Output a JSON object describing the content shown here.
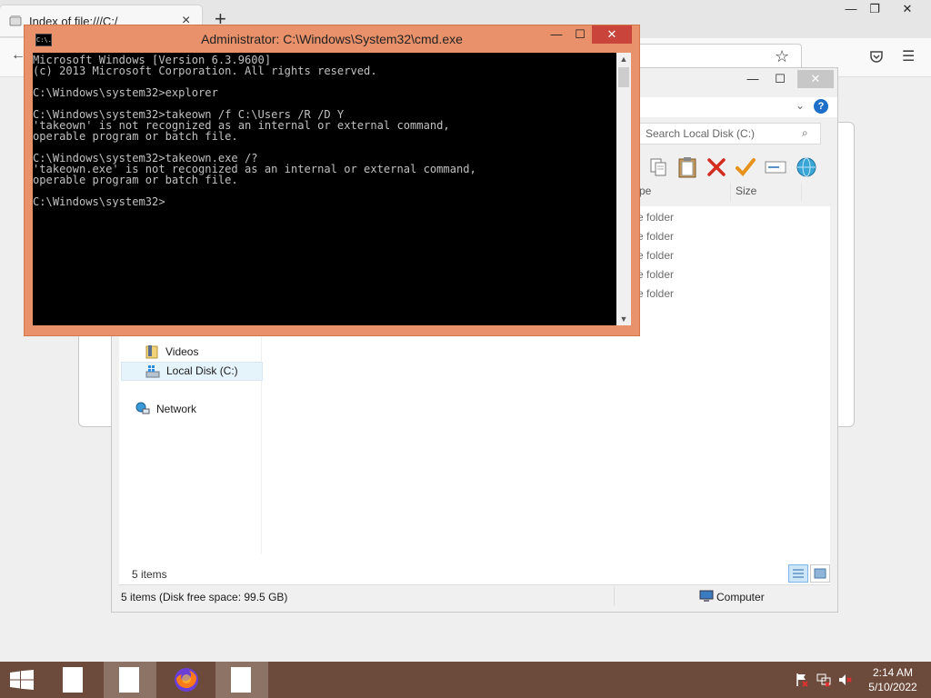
{
  "browser": {
    "tab_title": "Index of file:///C:/",
    "new_tab_symbol": "+",
    "back_symbol": "←",
    "menu_symbol": "☰",
    "star_symbol": "☆",
    "window_controls": {
      "minimize": "—",
      "restore": "❐",
      "close": "✕"
    }
  },
  "explorer": {
    "window_controls": {
      "minimize": "—",
      "maximize": "☐",
      "close": "✕"
    },
    "search_placeholder": "Search Local Disk (C:)",
    "help_symbol": "?",
    "columns": {
      "type": "pe",
      "size": "Size"
    },
    "rows": [
      "e folder",
      "e folder",
      "e folder",
      "e folder",
      "e folder"
    ],
    "nav": [
      {
        "label": "Videos",
        "icon": "videos-icon"
      },
      {
        "label": "Local Disk (C:)",
        "icon": "drive-icon",
        "selected": true
      },
      {
        "label": "Network",
        "icon": "network-icon"
      }
    ],
    "item_count": "5 items",
    "status_left": "5 items (Disk free space: 99.5 GB)",
    "status_right": "Computer",
    "toolbar_icons": [
      "copy-icon",
      "paste-icon",
      "delete-icon",
      "checkmark-icon",
      "rename-icon",
      "globe-icon"
    ]
  },
  "cmd": {
    "title": "Administrator: C:\\Windows\\System32\\cmd.exe",
    "icon_label": "C:\\.",
    "window_controls": {
      "minimize": "—",
      "maximize": "☐",
      "close": "✕"
    },
    "lines": [
      "Microsoft Windows [Version 6.3.9600]",
      "(c) 2013 Microsoft Corporation. All rights reserved.",
      "",
      "C:\\Windows\\system32>explorer",
      "",
      "C:\\Windows\\system32>takeown /f C:\\Users /R /D Y",
      "'takeown' is not recognized as an internal or external command,",
      "operable program or batch file.",
      "",
      "C:\\Windows\\system32>takeown.exe /?",
      "'takeown.exe' is not recognized as an internal or external command,",
      "operable program or batch file.",
      "",
      "C:\\Windows\\system32>"
    ]
  },
  "taskbar": {
    "clock_time": "2:14 AM",
    "clock_date": "5/10/2022",
    "buttons": [
      "start-button",
      "notepad-button",
      "document-button",
      "firefox-button",
      "document-active-button"
    ]
  },
  "colors": {
    "cmd_frame": "#e9916a",
    "cmd_close": "#c9443a",
    "taskbar": "#6d4b3c",
    "console_bg": "#000000",
    "console_text": "#c0c0c0"
  }
}
